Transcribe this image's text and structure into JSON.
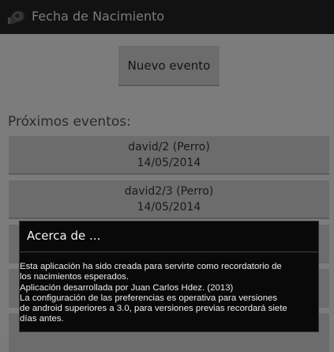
{
  "app": {
    "title": "Fecha de Nacimiento",
    "icon": "app-logo-icon"
  },
  "main": {
    "new_event_label": "Nuevo evento",
    "upcoming_label": "Próximos eventos:",
    "events": [
      {
        "name": "david/2 (Perro)",
        "date": "14/05/2014"
      },
      {
        "name": "david2/3 (Perro)",
        "date": "14/05/2014"
      }
    ]
  },
  "dialog": {
    "title": "Acerca de ...",
    "lines": [
      "Esta aplicación ha sido creada para servirte como recordatorio de",
      "los nacimientos esperados.",
      "Aplicación desarrollada por Juan Carlos Hdez. (2013)",
      "La configuración de las preferencias es operativa para versiones",
      "de android superiores a 3.0, para versiones previas recordará siete",
      "días antes."
    ]
  },
  "colors": {
    "actionbar": "#121212",
    "dimmed_bg": "#7c7c7c",
    "dialog_bg": "#090909"
  }
}
